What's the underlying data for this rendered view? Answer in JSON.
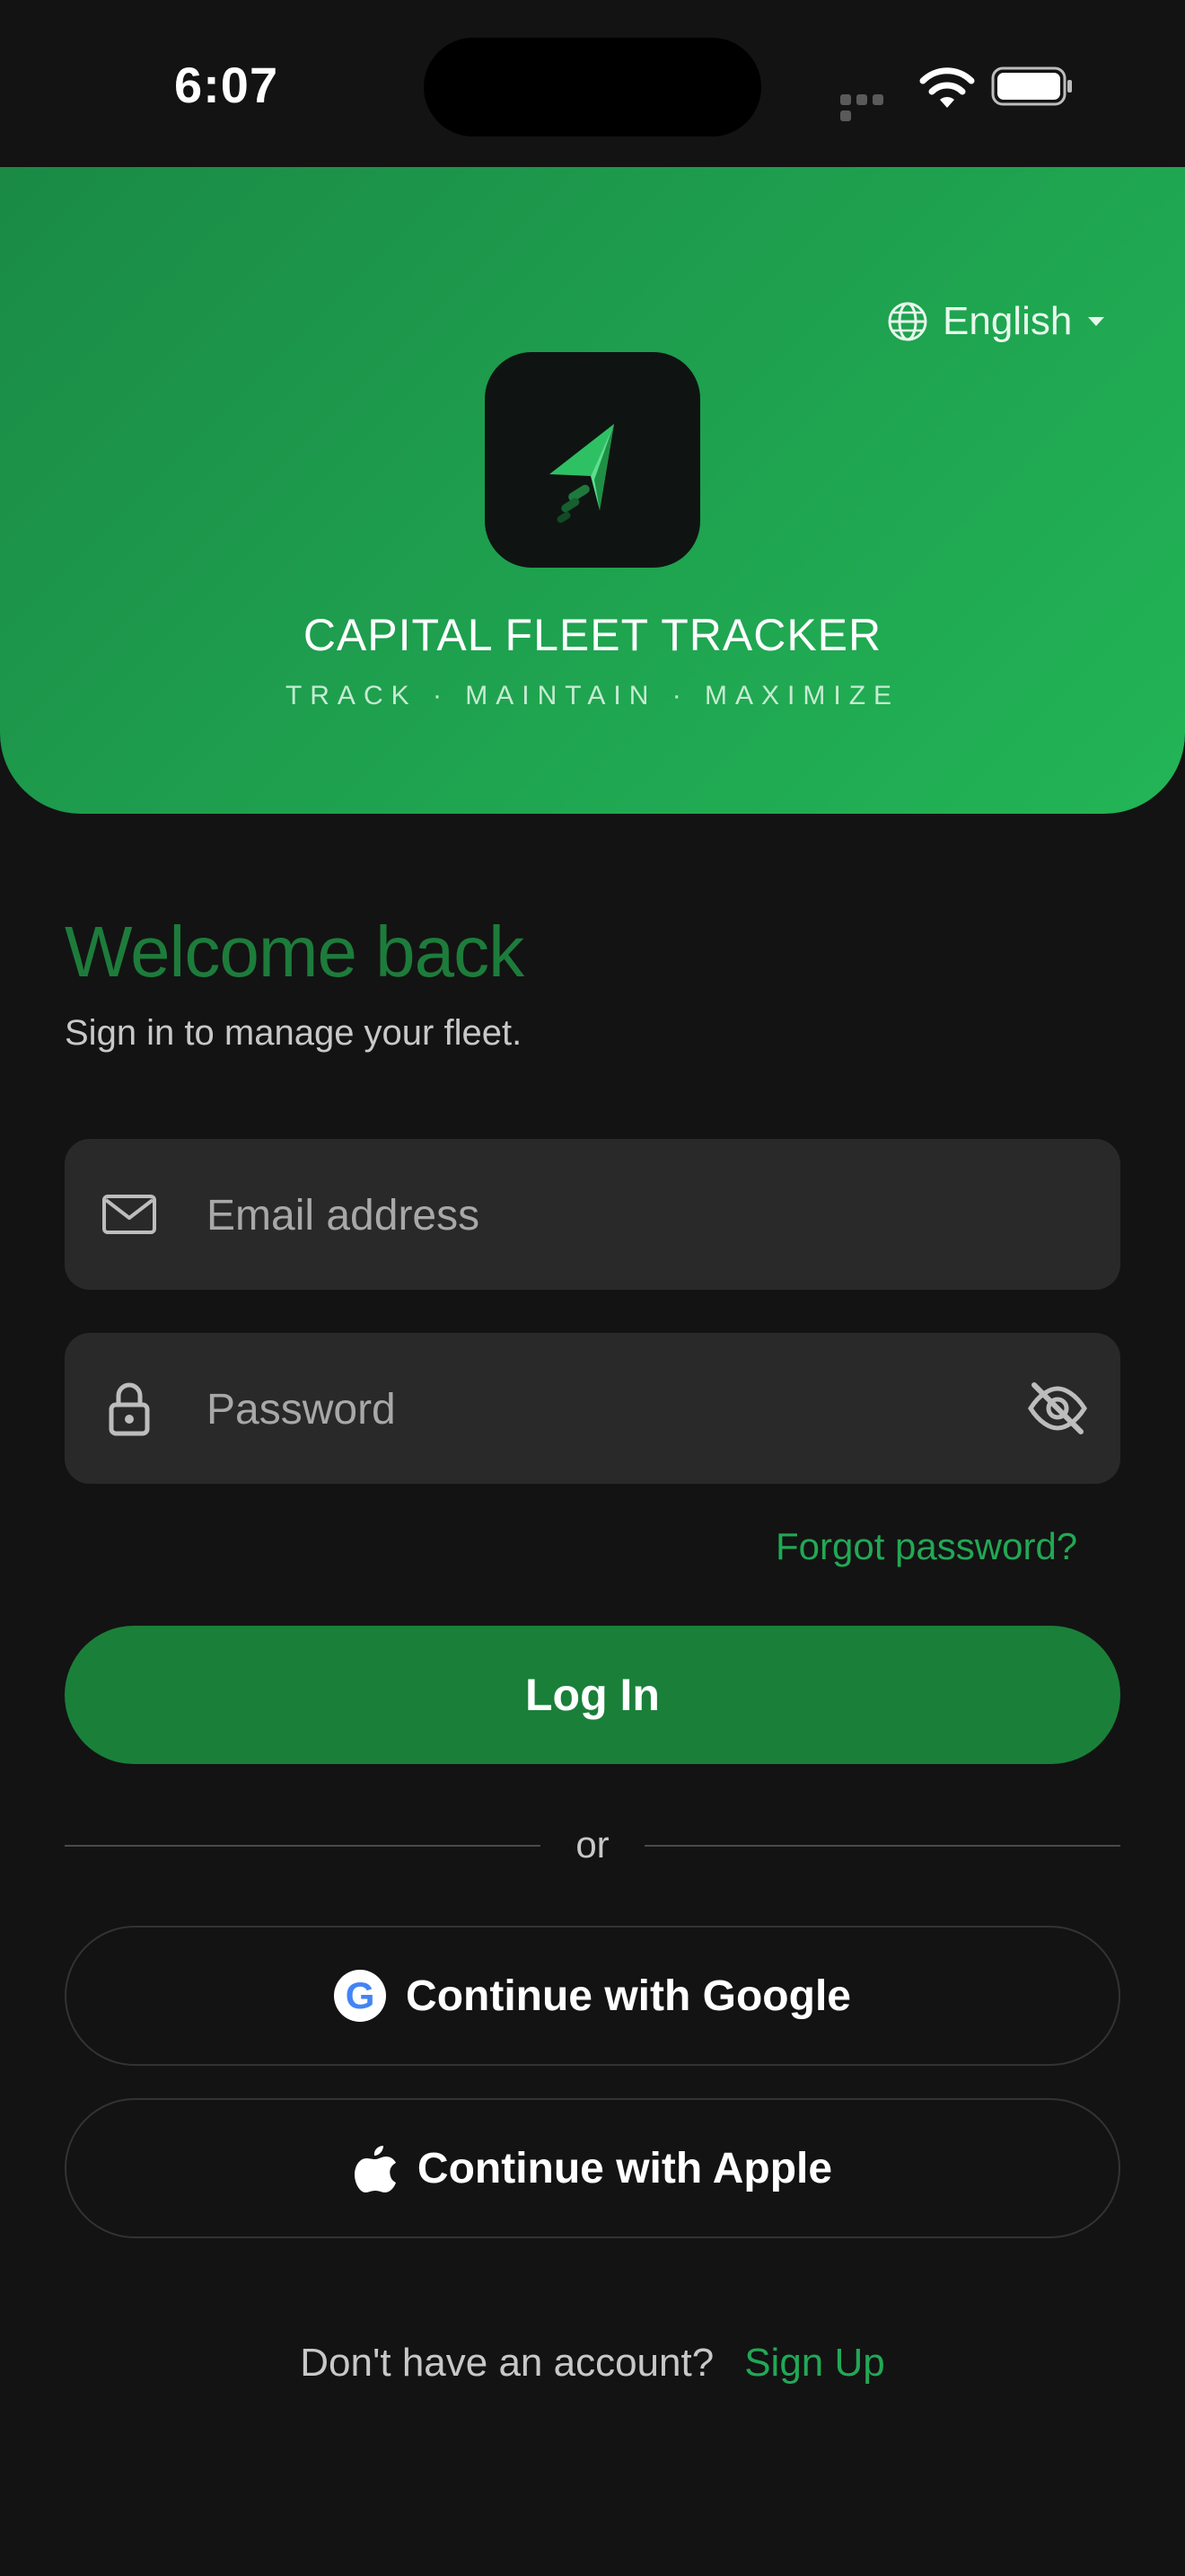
{
  "status_bar": {
    "time": "6:07",
    "icons": [
      "cellular-icon",
      "wifi-icon",
      "battery-icon"
    ]
  },
  "header": {
    "language": {
      "label": "English",
      "icon": "globe-icon"
    },
    "logo_icon": "paper-plane-icon",
    "brand": "CAPITAL FLEET TRACKER",
    "tagline": "TRACK · MAINTAIN · MAXIMIZE"
  },
  "welcome": {
    "title": "Welcome back",
    "subtitle": "Sign in to manage your fleet."
  },
  "form": {
    "email": {
      "placeholder": "Email address",
      "value": "",
      "icon": "mail-icon"
    },
    "password": {
      "placeholder": "Password",
      "value": "",
      "icon": "lock-icon",
      "toggle_icon": "eye-off-icon"
    },
    "forgot_label": "Forgot password?",
    "login_label": "Log In"
  },
  "divider_label": "or",
  "oauth": {
    "google_label": "Continue with Google",
    "google_badge": "G",
    "apple_label": "Continue with Apple"
  },
  "signup": {
    "question": "Don't have an account?",
    "link": "Sign Up"
  },
  "colors": {
    "accent": "#22a855",
    "primary_button": "#1a8039",
    "background": "#131313",
    "field_bg": "#292929"
  }
}
